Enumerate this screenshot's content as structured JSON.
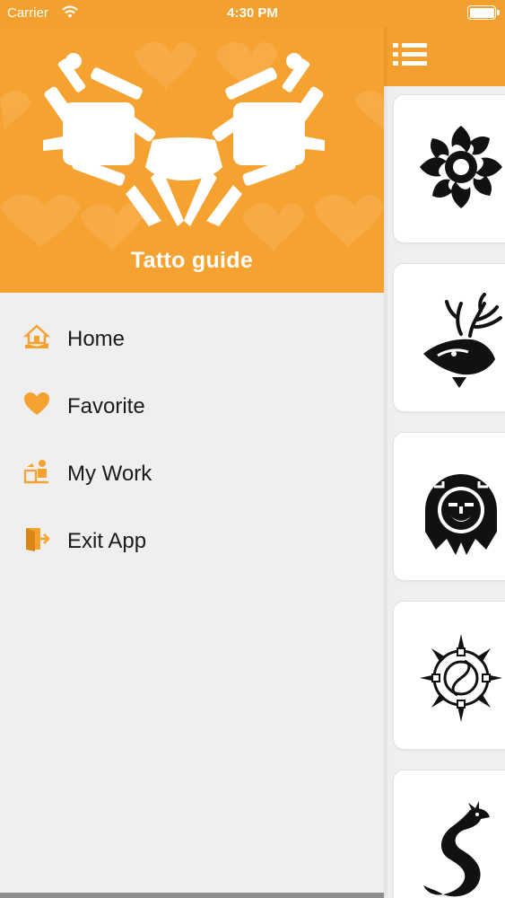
{
  "status_bar": {
    "carrier": "Carrier",
    "time": "4:30 PM"
  },
  "drawer": {
    "app_title": "Tatto guide",
    "items": [
      {
        "label": "Home",
        "icon": "home-icon"
      },
      {
        "label": "Favorite",
        "icon": "heart-icon"
      },
      {
        "label": "My Work",
        "icon": "work-desk-icon"
      },
      {
        "label": "Exit App",
        "icon": "exit-door-icon"
      }
    ]
  },
  "main": {
    "menu_icon": "list-icon",
    "cards": [
      {
        "icon": "tribal-sun-tattoo"
      },
      {
        "icon": "tribal-deer-tattoo"
      },
      {
        "icon": "aztec-sun-mask-tattoo"
      },
      {
        "icon": "tribal-spiral-sun-tattoo"
      },
      {
        "icon": "tribal-dragon-tattoo"
      }
    ]
  },
  "colors": {
    "accent": "#f5a230",
    "drawer_bg": "#efefef",
    "text": "#1b1b1b"
  }
}
